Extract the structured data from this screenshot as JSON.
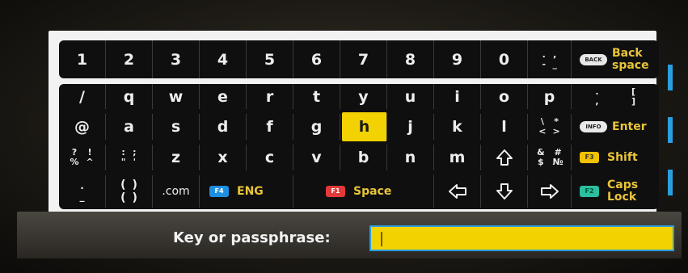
{
  "keyboard": {
    "number_row": [
      "1",
      "2",
      "3",
      "4",
      "5",
      "6",
      "7",
      "8",
      "9",
      "0"
    ],
    "number_row_symbols": [
      ".",
      ",",
      "-",
      "_"
    ],
    "back_button_text": "BACK",
    "backspace_label": "Back space",
    "row2": [
      "/",
      "q",
      "w",
      "e",
      "r",
      "t",
      "y",
      "u",
      "i",
      "o",
      "p"
    ],
    "row2_symbols": [
      ".",
      ",",
      "[",
      "]"
    ],
    "row3": [
      "@",
      "a",
      "s",
      "d",
      "f",
      "g",
      "h",
      "j",
      "k",
      "l"
    ],
    "row3_symbols": [
      "\\",
      "*",
      "<",
      ">"
    ],
    "info_button_text": "INFO",
    "enter_label": "Enter",
    "row4_first_symbols": [
      "?",
      "!",
      "%",
      "^"
    ],
    "row4_colon_symbols": [
      ":",
      ";",
      "\"",
      "'"
    ],
    "row4": [
      "z",
      "x",
      "c",
      "v",
      "b",
      "n",
      "m"
    ],
    "row4_hash_symbols": [
      "&",
      "#",
      "$",
      "№"
    ],
    "shift_fkey": "F3",
    "shift_label": "Shift",
    "row5_dot_symbols": [
      ".",
      "_"
    ],
    "row5_paren_symbols": [
      "(",
      ")",
      "(",
      ")"
    ],
    "dotcom_label": ".com",
    "lang_fkey": "F4",
    "lang_label": "ENG",
    "space_fkey": "F1",
    "space_label": "Space",
    "caps_fkey": "F2",
    "caps_label": "Caps Lock",
    "selected_key": "h",
    "colors": {
      "selected": "#f2d200",
      "accent": "#2a9fdf",
      "label_yellow": "#e9c43a"
    }
  },
  "input": {
    "label": "Key or passphrase:",
    "value": ""
  }
}
